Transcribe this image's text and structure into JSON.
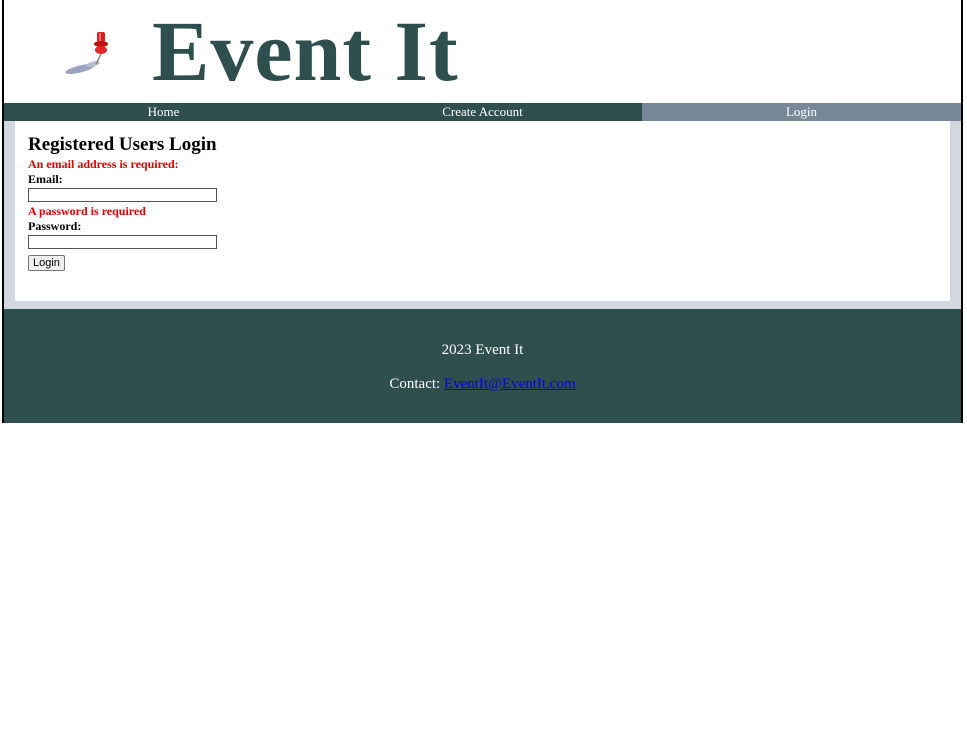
{
  "header": {
    "title": "Event It",
    "logo_icon": "pushpin-icon"
  },
  "nav": {
    "items": [
      {
        "label": "Home",
        "active": false
      },
      {
        "label": "Create Account",
        "active": false
      },
      {
        "label": "Login",
        "active": true
      }
    ]
  },
  "login": {
    "heading": "Registered Users Login",
    "email_error": "An email address is required:",
    "email_label": "Email:",
    "email_value": "",
    "password_error": "A password is required",
    "password_label": "Password:",
    "password_value": "",
    "submit_label": "Login"
  },
  "footer": {
    "year_text": "2023 Event It",
    "contact_label": "Contact:",
    "contact_email": "EventIt@EventIt.com"
  },
  "colors": {
    "brand": "#2f4f4f",
    "nav_active": "#778899",
    "error": "#e00000",
    "link": "#0000ee"
  }
}
